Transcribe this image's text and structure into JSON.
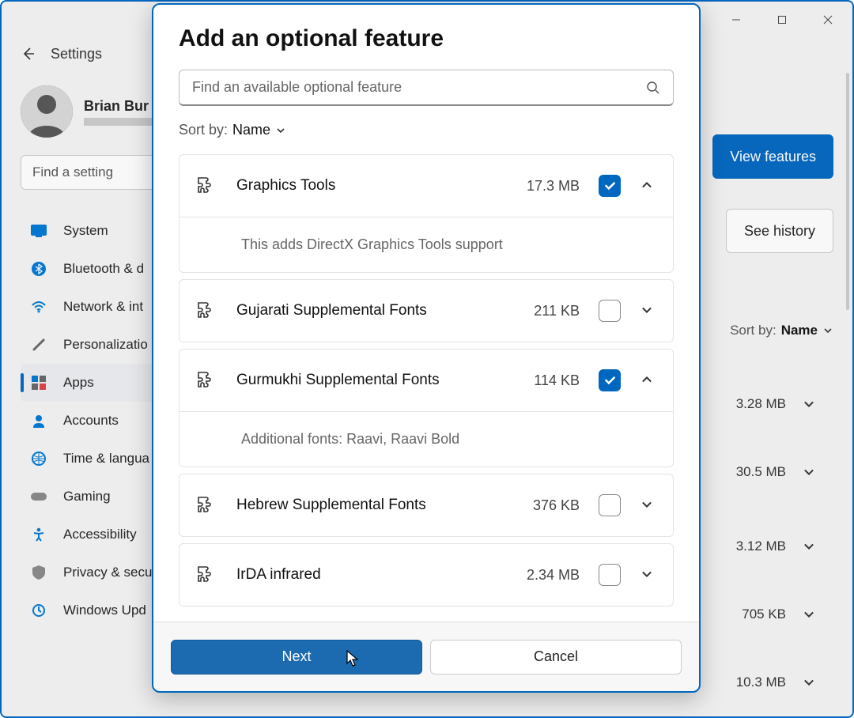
{
  "window": {
    "title": "Settings",
    "user_name": "Brian Bur",
    "find_setting_placeholder": "Find a setting",
    "nav": [
      {
        "label": "System"
      },
      {
        "label": "Bluetooth & d"
      },
      {
        "label": "Network & int"
      },
      {
        "label": "Personalizatio"
      },
      {
        "label": "Apps"
      },
      {
        "label": "Accounts"
      },
      {
        "label": "Time & langua"
      },
      {
        "label": "Gaming"
      },
      {
        "label": "Accessibility"
      },
      {
        "label": "Privacy & secu"
      },
      {
        "label": "Windows Upd"
      }
    ],
    "view_features": "View features",
    "see_history": "See history",
    "sort_label": "Sort by:",
    "sort_value": "Name",
    "bg_rows": [
      {
        "size": "3.28 MB"
      },
      {
        "size": "30.5 MB"
      },
      {
        "size": "3.12 MB"
      },
      {
        "size": "705 KB"
      },
      {
        "size": "10.3 MB"
      }
    ]
  },
  "dialog": {
    "title": "Add an optional feature",
    "search_placeholder": "Find an available optional feature",
    "sort_label": "Sort by:",
    "sort_value": "Name",
    "features": [
      {
        "name": "Graphics Tools",
        "size": "17.3 MB",
        "checked": true,
        "expanded": true,
        "desc": "This adds DirectX Graphics Tools support"
      },
      {
        "name": "Gujarati Supplemental Fonts",
        "size": "211 KB",
        "checked": false,
        "expanded": false
      },
      {
        "name": "Gurmukhi Supplemental Fonts",
        "size": "114 KB",
        "checked": true,
        "expanded": true,
        "desc": "Additional fonts: Raavi, Raavi Bold"
      },
      {
        "name": "Hebrew Supplemental Fonts",
        "size": "376 KB",
        "checked": false,
        "expanded": false
      },
      {
        "name": "IrDA infrared",
        "size": "2.34 MB",
        "checked": false,
        "expanded": false
      }
    ],
    "next": "Next",
    "cancel": "Cancel"
  }
}
